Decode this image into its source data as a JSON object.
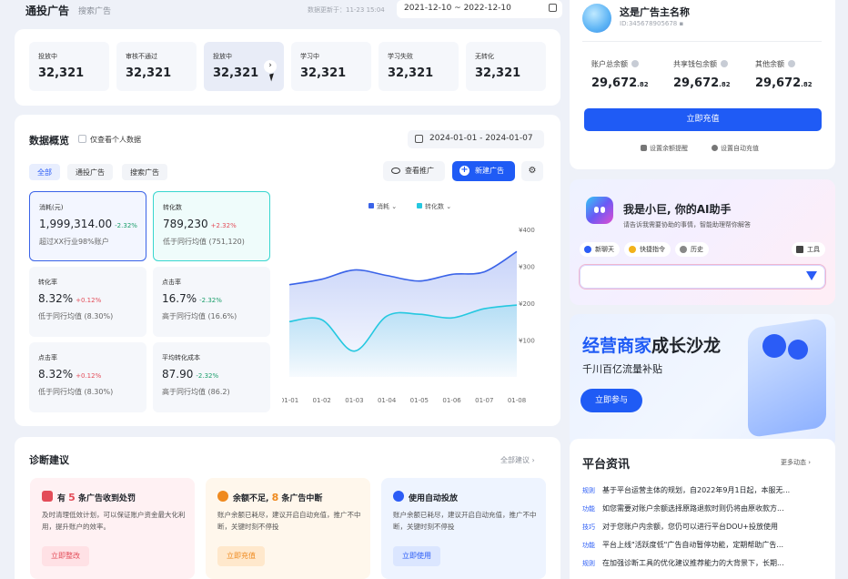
{
  "header": {
    "title": "通投广告",
    "tab": "搜索广告",
    "updated": "数据更新于：11-23 15:04",
    "date_range": "2021-12-10 ~ 2022-12-10"
  },
  "stats": [
    {
      "label": "投放中",
      "value": "32,321"
    },
    {
      "label": "审核不通过",
      "value": "32,321"
    },
    {
      "label": "投放中",
      "value": "32,321"
    },
    {
      "label": "学习中",
      "value": "32,321"
    },
    {
      "label": "学习失败",
      "value": "32,321"
    },
    {
      "label": "无转化",
      "value": "32,321"
    }
  ],
  "overview": {
    "title": "数据概览",
    "checkbox_label": "仅查看个人数据",
    "date_range": "2024-01-01 - 2024-01-07",
    "tabs": [
      "全部",
      "通投广告",
      "搜索广告"
    ],
    "view_btn": "查看推广",
    "new_btn": "新建广告",
    "settings_glyph": "⚙",
    "metrics": [
      {
        "label": "消耗(元)",
        "value": "1,999,314.00",
        "change": "-2.32%",
        "sub": "超过XX行业98%账户"
      },
      {
        "label": "转化数",
        "value": "789,230",
        "change": "+2.32%",
        "sub": "低于同行均值 (751,120)"
      },
      {
        "label": "转化率",
        "value": "8.32%",
        "change": "+0.12%",
        "sub": "低于同行均值 (8.30%)"
      },
      {
        "label": "点击率",
        "value": "16.7%",
        "change": "-2.32%",
        "sub": "高于同行均值 (16.6%)"
      },
      {
        "label": "点击率",
        "value": "8.32%",
        "change": "+0.12%",
        "sub": "低于同行均值 (8.30%)"
      },
      {
        "label": "平均转化成本",
        "value": "87.90",
        "change": "-2.32%",
        "sub": "高于同行均值 (86.2)"
      }
    ]
  },
  "chart_data": {
    "type": "area",
    "x": [
      "01-01",
      "01-02",
      "01-03",
      "01-04",
      "01-05",
      "01-06",
      "01-07",
      "01-08"
    ],
    "y_ticks": [
      "¥400",
      "¥300",
      "¥200",
      "¥100"
    ],
    "ylim": [
      0,
      400
    ],
    "series": [
      {
        "name": "消耗",
        "color": "#3a63e8",
        "values": [
          250,
          265,
          290,
          275,
          260,
          278,
          285,
          340
        ]
      },
      {
        "name": "转化数",
        "color": "#25c8e0",
        "values": [
          150,
          155,
          70,
          165,
          170,
          160,
          185,
          195
        ]
      }
    ]
  },
  "diagnosis": {
    "title": "诊断建议",
    "more": "全部建议",
    "cards": [
      {
        "pre": "有",
        "num": "5",
        "post": "条广告收到处罚",
        "desc": "及时清理低效计划，可以保证账户资金最大化利用，提升账户的效率。",
        "btn": "立即整改",
        "bg": "#fff1f3",
        "accent": "#e34d59"
      },
      {
        "pre": "余额不足,",
        "num": "8",
        "post": "条广告中断",
        "desc": "账户余额已耗尽，建议开启自动充值，推广不中断，关键时刻不停投",
        "btn": "立即充值",
        "bg": "#fff7ec",
        "accent": "#ef8a1f"
      },
      {
        "pre": "",
        "num": "",
        "post": "使用自动投放",
        "desc": "账户余额已耗尽，建议开启自动充值，推广不中断，关键时刻不停投",
        "btn": "立即使用",
        "bg": "#eef4ff",
        "accent": "#2b5cf6"
      }
    ]
  },
  "account": {
    "name": "这是广告主名称",
    "id": "ID:345678905678",
    "balances": [
      {
        "label": "账户总余额",
        "int": "29,672",
        "dec": ".82"
      },
      {
        "label": "共享钱包余额",
        "int": "29,672",
        "dec": ".82"
      },
      {
        "label": "其他余额",
        "int": "29,672",
        "dec": ".82"
      }
    ],
    "recharge": "立即充值",
    "links": [
      "设置余额提醒",
      "设置自动充值"
    ]
  },
  "ai": {
    "title": "我是小巨, 你的AI助手",
    "subtitle": "请告诉我需要协助的事情，智能助理帮你解答",
    "chips": [
      "新聊天",
      "快捷指令",
      "历史"
    ],
    "tools": "工具",
    "input_placeholder": ""
  },
  "promo": {
    "title_a": "经营商家",
    "title_b": "成长沙龙",
    "subtitle": "千川百亿流量补贴",
    "btn": "立即参与"
  },
  "news": {
    "title": "平台资讯",
    "more": "更多动态",
    "items": [
      {
        "tag": "规则",
        "text": "基于平台运营主体的规划，自2022年9月1日起，本服无..."
      },
      {
        "tag": "功能",
        "text": "如您需要对账户余额选择原路退款时则仍将由原收款方..."
      },
      {
        "tag": "技巧",
        "text": "对于您账户内余额，您仍可以进行平台DOU+投放使用"
      },
      {
        "tag": "功能",
        "text": "平台上线\"活跃度低\"广告自动暂停功能，定期帮助广告..."
      },
      {
        "tag": "规则",
        "text": "在加强诊断工具的优化建议推荐能力的大背景下，长期..."
      }
    ]
  }
}
